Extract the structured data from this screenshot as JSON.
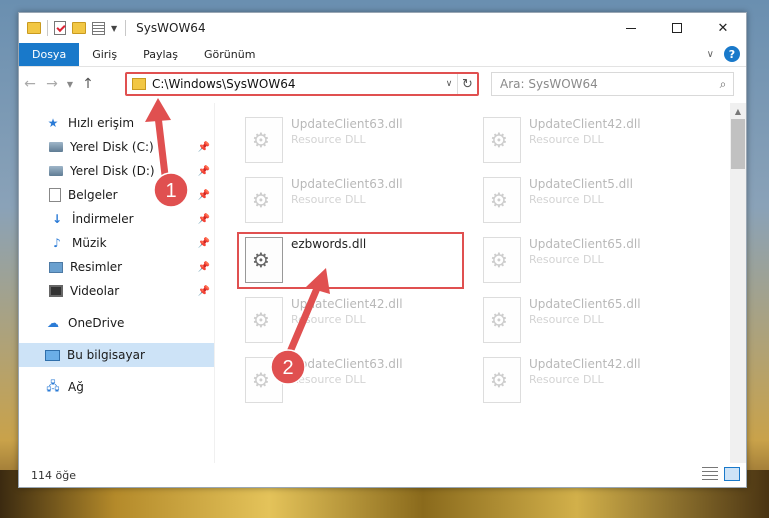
{
  "window": {
    "title": "SysWOW64"
  },
  "ribbon": {
    "tabs": [
      "Dosya",
      "Giriş",
      "Paylaş",
      "Görünüm"
    ],
    "help": "?"
  },
  "address": {
    "path": "C:\\Windows\\SysWOW64",
    "search_placeholder": "Ara: SysWOW64"
  },
  "sidebar": {
    "quick_access": "Hızlı erişim",
    "items": [
      {
        "label": "Yerel Disk (C:)",
        "icon": "disk-icon"
      },
      {
        "label": "Yerel Disk (D:)",
        "icon": "disk-icon"
      },
      {
        "label": "Belgeler",
        "icon": "documents-icon"
      },
      {
        "label": "İndirmeler",
        "icon": "download-icon"
      },
      {
        "label": "Müzik",
        "icon": "music-icon"
      },
      {
        "label": "Resimler",
        "icon": "pictures-icon"
      },
      {
        "label": "Videolar",
        "icon": "videos-icon"
      }
    ],
    "onedrive": "OneDrive",
    "this_pc": "Bu bilgisayar",
    "network": "Ağ"
  },
  "files": [
    {
      "name": "UpdateClient63.dll",
      "type": "Resource DLL",
      "faded": true
    },
    {
      "name": "UpdateClient42.dll",
      "type": "Resource DLL",
      "faded": true
    },
    {
      "name": "UpdateClient63.dll",
      "type": "Resource DLL",
      "faded": true
    },
    {
      "name": "UpdateClient5.dll",
      "type": "Resource DLL",
      "faded": true
    },
    {
      "name": "ezbwords.dll",
      "type": "",
      "faded": false
    },
    {
      "name": "UpdateClient65.dll",
      "type": "Resource DLL",
      "faded": true
    },
    {
      "name": "UpdateClient42.dll",
      "type": "Resource DLL",
      "faded": true
    },
    {
      "name": "UpdateClient65.dll",
      "type": "Resource DLL",
      "faded": true
    },
    {
      "name": "UpdateClient63.dll",
      "type": "Resource DLL",
      "faded": true
    },
    {
      "name": "UpdateClient42.dll",
      "type": "Resource DLL",
      "faded": true
    }
  ],
  "status": {
    "count": "114 öğe"
  },
  "annotations": {
    "step1": "1",
    "step2": "2",
    "color": "#e05050"
  }
}
